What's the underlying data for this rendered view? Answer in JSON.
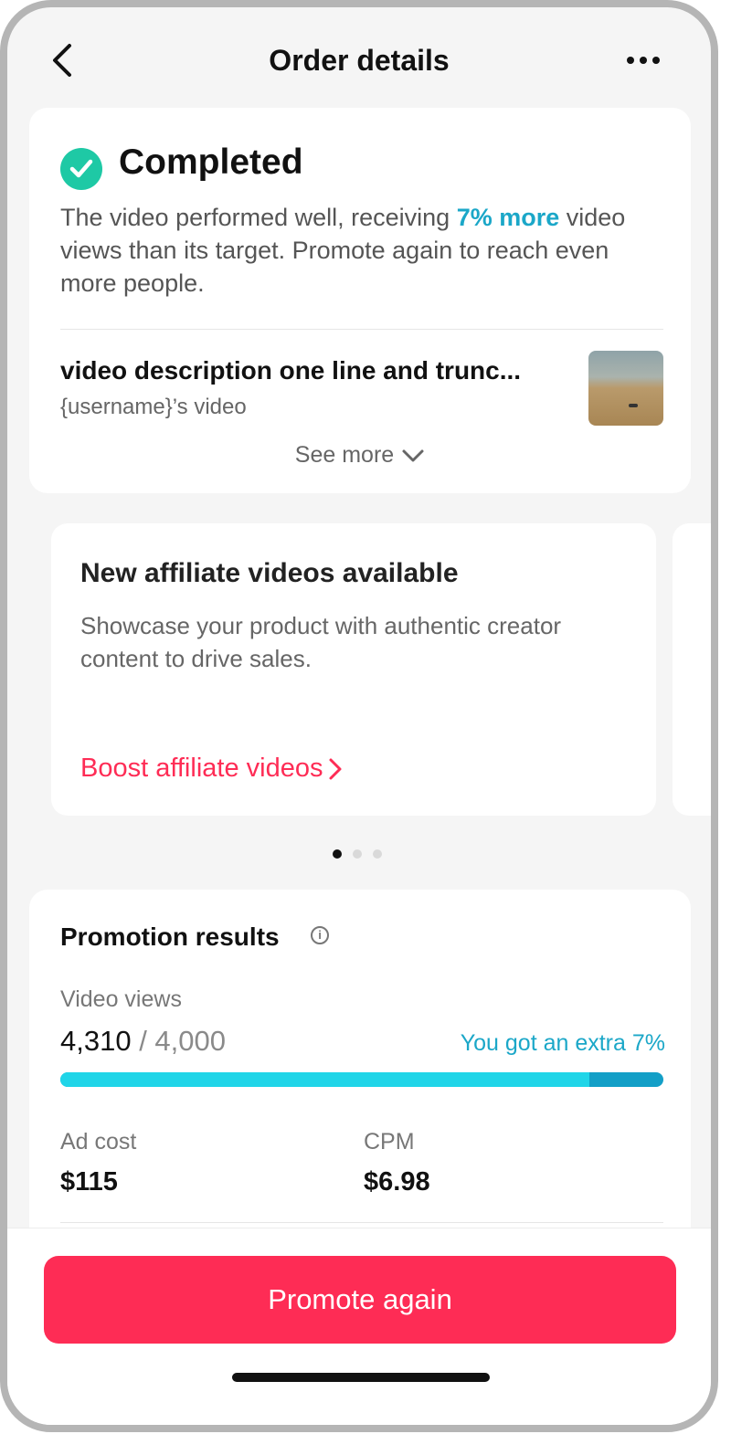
{
  "header": {
    "title": "Order details"
  },
  "status_card": {
    "status": "Completed",
    "description_pre": "The video performed well, receiving ",
    "description_highlight": "7% more",
    "description_post": " video views than its target. Promote again to reach even more people.",
    "video_title": "video description one line and trunc...",
    "video_user": "{username}’s video",
    "see_more": "See more"
  },
  "carousel": {
    "card_title": "New affiliate videos available",
    "card_description": "Showcase your product with authentic creator content to drive sales.",
    "card_link": "Boost affiliate videos",
    "active_index": 0,
    "total": 3
  },
  "results": {
    "title": "Promotion results",
    "views_label": "Video views",
    "views_value": "4,310",
    "views_separator": " / ",
    "views_target": "4,000",
    "extra_text": "You got an extra 7%",
    "progress_fraction": 0.877,
    "ad_cost_label": "Ad cost",
    "ad_cost_value": "$115",
    "cpm_label": "CPM",
    "cpm_value": "$6.98"
  },
  "footer": {
    "button_label": "Promote again"
  },
  "colors": {
    "accent": "#fe2c55",
    "success": "#1ec9a5",
    "highlight": "#1ba7c8",
    "progress": "#20d5e8"
  },
  "icons": [
    "back-icon",
    "more-icon",
    "check-icon",
    "chevron-down-icon",
    "chevron-right-icon",
    "info-icon"
  ]
}
